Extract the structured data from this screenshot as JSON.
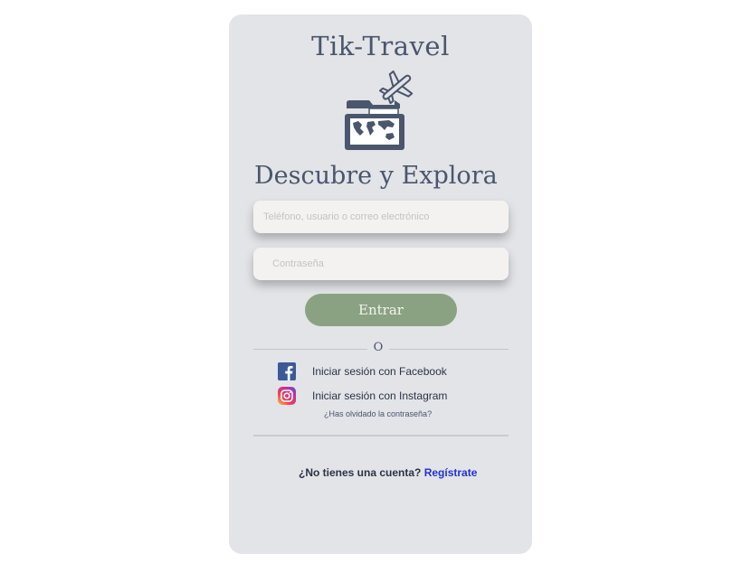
{
  "app": {
    "title": "Tik-Travel",
    "tagline": "Descubre y Explora",
    "logo_icon": "folder-world-map-airplane-icon"
  },
  "form": {
    "username_placeholder": "Teléfono, usuario o correo electrónico",
    "password_placeholder": "Contraseña",
    "submit_label": "Entrar"
  },
  "divider": {
    "label": "O"
  },
  "social": {
    "facebook_label": "Iniciar sesión con Facebook",
    "facebook_icon": "facebook-icon",
    "instagram_label": "Iniciar sesión con Instagram",
    "instagram_icon": "instagram-icon"
  },
  "forgot_password": "¿Has olvidado la contraseña?",
  "signup": {
    "prompt": "¿No tienes una cuenta?",
    "link": "Regístrate"
  },
  "colors": {
    "card_bg": "#e2e4e7",
    "title": "#4a566c",
    "button": "#8aa282",
    "link": "#2231d6"
  }
}
